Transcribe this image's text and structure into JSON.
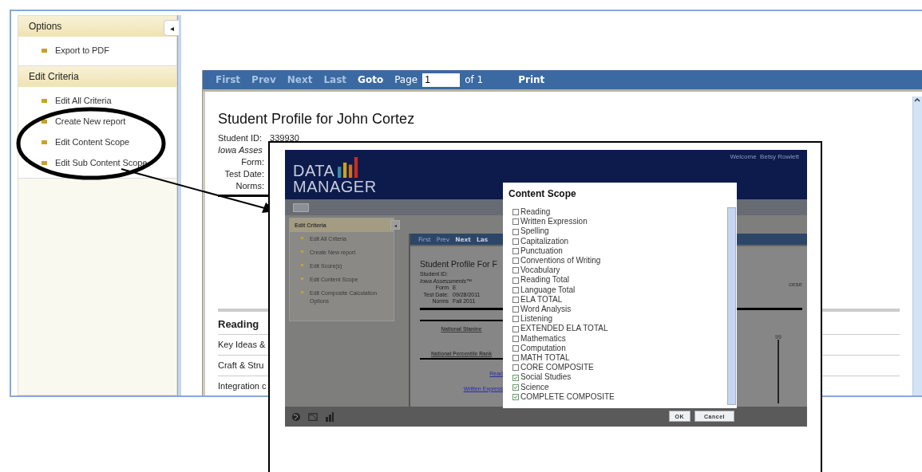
{
  "sidebar": {
    "collapse_glyph": "◂",
    "sections": [
      {
        "title": "Options",
        "items": [
          "Export to PDF"
        ]
      },
      {
        "title": "Edit Criteria",
        "items": [
          "Edit All Criteria",
          "Create New report",
          "Edit Content Scope",
          "Edit Sub Content Scope"
        ]
      }
    ]
  },
  "toolbar": {
    "nav": [
      {
        "label": "First",
        "disabled": true
      },
      {
        "label": "Prev",
        "disabled": true
      },
      {
        "label": "Next",
        "disabled": true
      },
      {
        "label": "Last",
        "disabled": true
      },
      {
        "label": "Goto",
        "disabled": false
      }
    ],
    "page_label": "Page",
    "page_value": "1",
    "page_total": "of 1",
    "print": "Print"
  },
  "report": {
    "title": "Student Profile for John Cortez",
    "fields": [
      {
        "label": "Student ID:",
        "value": "339930",
        "kind": "plain"
      },
      {
        "label": "Iowa Asses",
        "kind": "italic"
      },
      {
        "label": "Form:",
        "kind": "right"
      },
      {
        "label": "Test Date:",
        "kind": "right"
      },
      {
        "label": "Norms:",
        "kind": "right"
      }
    ],
    "section": "Reading",
    "rows": [
      "Key Ideas &",
      "Craft & Stru",
      "Integration c"
    ]
  },
  "inset": {
    "logo": [
      "DATA",
      "MANAGER"
    ],
    "welcome": "Welcome  Betsy Rowlett",
    "sidebar": {
      "title": "Edit Criteria",
      "collapse_glyph": "◂",
      "items": [
        "Edit All Criteria",
        "Create New report",
        "Edit Score(s)",
        "Edit Content Scope",
        "Edit Composite Calculation Options"
      ]
    },
    "report": {
      "nav": [
        {
          "label": "First",
          "disabled": true
        },
        {
          "label": "Prev",
          "disabled": true
        },
        {
          "label": "Next",
          "disabled": false
        },
        {
          "label": "Las",
          "disabled": false
        }
      ],
      "title": "Student Profile For F",
      "fields": [
        {
          "label": "Student ID:",
          "kind": "plain"
        },
        {
          "label": "Iowa Assessments™",
          "kind": "italic"
        },
        {
          "label": "Form",
          "value": "E",
          "kind": "right"
        },
        {
          "label": "Test Date:",
          "value": "09/28/2011",
          "kind": "right"
        },
        {
          "label": "Norms",
          "value": "Fall 2011",
          "kind": "right"
        }
      ],
      "side_note": "cese",
      "headings": [
        "National Stanine",
        "National Percentile Rank"
      ],
      "links": [
        "Read",
        "Written Express"
      ],
      "score": "99"
    },
    "dialog": {
      "title": "Content Scope",
      "items": [
        {
          "label": "Reading",
          "checked": false
        },
        {
          "label": "Written Expression",
          "checked": false
        },
        {
          "label": "Spelling",
          "checked": false
        },
        {
          "label": "Capitalization",
          "checked": false
        },
        {
          "label": "Punctuation",
          "checked": false
        },
        {
          "label": "Conventions of Writing",
          "checked": false
        },
        {
          "label": "Vocabulary",
          "checked": false
        },
        {
          "label": "Reading Total",
          "checked": false
        },
        {
          "label": "Language Total",
          "checked": false
        },
        {
          "label": "ELA TOTAL",
          "checked": false
        },
        {
          "label": "Word Analysis",
          "checked": false
        },
        {
          "label": "Listening",
          "checked": false
        },
        {
          "label": "EXTENDED ELA TOTAL",
          "checked": false
        },
        {
          "label": "Mathematics",
          "checked": false
        },
        {
          "label": "Computation",
          "checked": false
        },
        {
          "label": "MATH TOTAL",
          "checked": false
        },
        {
          "label": "CORE COMPOSITE",
          "checked": false
        },
        {
          "label": "Social Studies",
          "checked": true
        },
        {
          "label": "Science",
          "checked": true
        },
        {
          "label": "COMPLETE COMPOSITE",
          "checked": true
        }
      ],
      "buttons": [
        "OK",
        "Cancel"
      ]
    }
  }
}
